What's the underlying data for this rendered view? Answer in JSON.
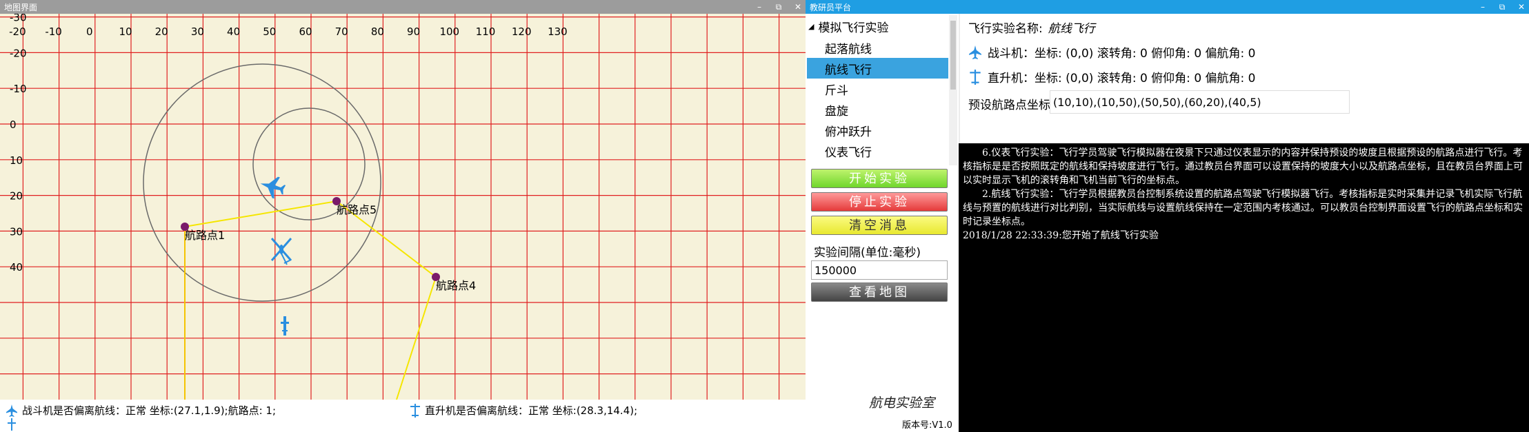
{
  "map_window": {
    "title": "地图界面",
    "controls": {
      "minimize": "–",
      "restore": "⧉",
      "close": "✕"
    },
    "x_ticks": [
      "-20",
      "-10",
      "0",
      "10",
      "20",
      "30",
      "40",
      "50",
      "60",
      "70",
      "80",
      "90",
      "100",
      "110",
      "120",
      "130"
    ],
    "y_ticks": [
      "-30",
      "-20",
      "-10",
      "0",
      "10",
      "20",
      "30",
      "40"
    ],
    "waypoint_labels": [
      "航路点1",
      "航路点5",
      "航路点4"
    ],
    "status": {
      "fighter": "战斗机是否偏离航线：正常  坐标:(27.1,1.9);航路点: 1;",
      "helicopter": "直升机是否偏离航线：正常  坐标:(28.3,14.4);"
    },
    "colors": {
      "background": "#f6f2da",
      "grid": "#e02020",
      "route": "#f5e600",
      "waypoint": "#7a1a6a",
      "aircraft": "#2a8fe0"
    }
  },
  "edu_window": {
    "title": "教研员平台",
    "controls": {
      "minimize": "–",
      "restore": "⧉",
      "close": "✕"
    },
    "tree": {
      "root": "模拟飞行实验",
      "items": [
        "起落航线",
        "航线飞行",
        "斤斗",
        "盘旋",
        "俯冲跃升",
        "仪表飞行"
      ],
      "selected_index": 1
    },
    "buttons": {
      "start": "开始实验",
      "stop": "停止实验",
      "clear": "清空消息",
      "view_map": "查看地图"
    },
    "interval_label": "实验间隔(单位:毫秒)",
    "interval_value": "150000",
    "logo": "航电实验室",
    "version": "版本号:V1.0",
    "info": {
      "experiment_label": "飞行实验名称:",
      "experiment_name": "航线飞行",
      "fighter": "战斗机：坐标: (0,0)  滚转角: 0  俯仰角: 0  偏航角: 0",
      "helicopter": "直升机：坐标: (0,0)  滚转角: 0  俯仰角: 0  偏航角: 0",
      "waypoints_label": "预设航路点坐标:",
      "waypoints_value": "(10,10),(10,50),(50,50),(60,20),(40,5)"
    },
    "log": [
      "　　6.仪表飞行实验：飞行学员驾驶飞行模拟器在夜景下只通过仪表显示的内容并保持预设的坡度且根据预设的航路点进行飞行。考核指标是是否按照既定的航线和保持坡度进行飞行。通过教员台界面可以设置保持的坡度大小以及航路点坐标，且在教员台界面上可以实时显示飞机的滚转角和飞机当前飞行的坐标点。",
      "　　2.航线飞行实验：飞行学员根据教员台控制系统设置的航路点驾驶飞行模拟器飞行。考核指标是实时采集并记录飞机实际飞行航线与预置的航线进行对比判别，当实际航线与设置航线保持在一定范围内考核通过。可以教员台控制界面设置飞行的航路点坐标和实时记录坐标点。",
      "2018/1/28  22:33:39:您开始了航线飞行实验"
    ]
  }
}
